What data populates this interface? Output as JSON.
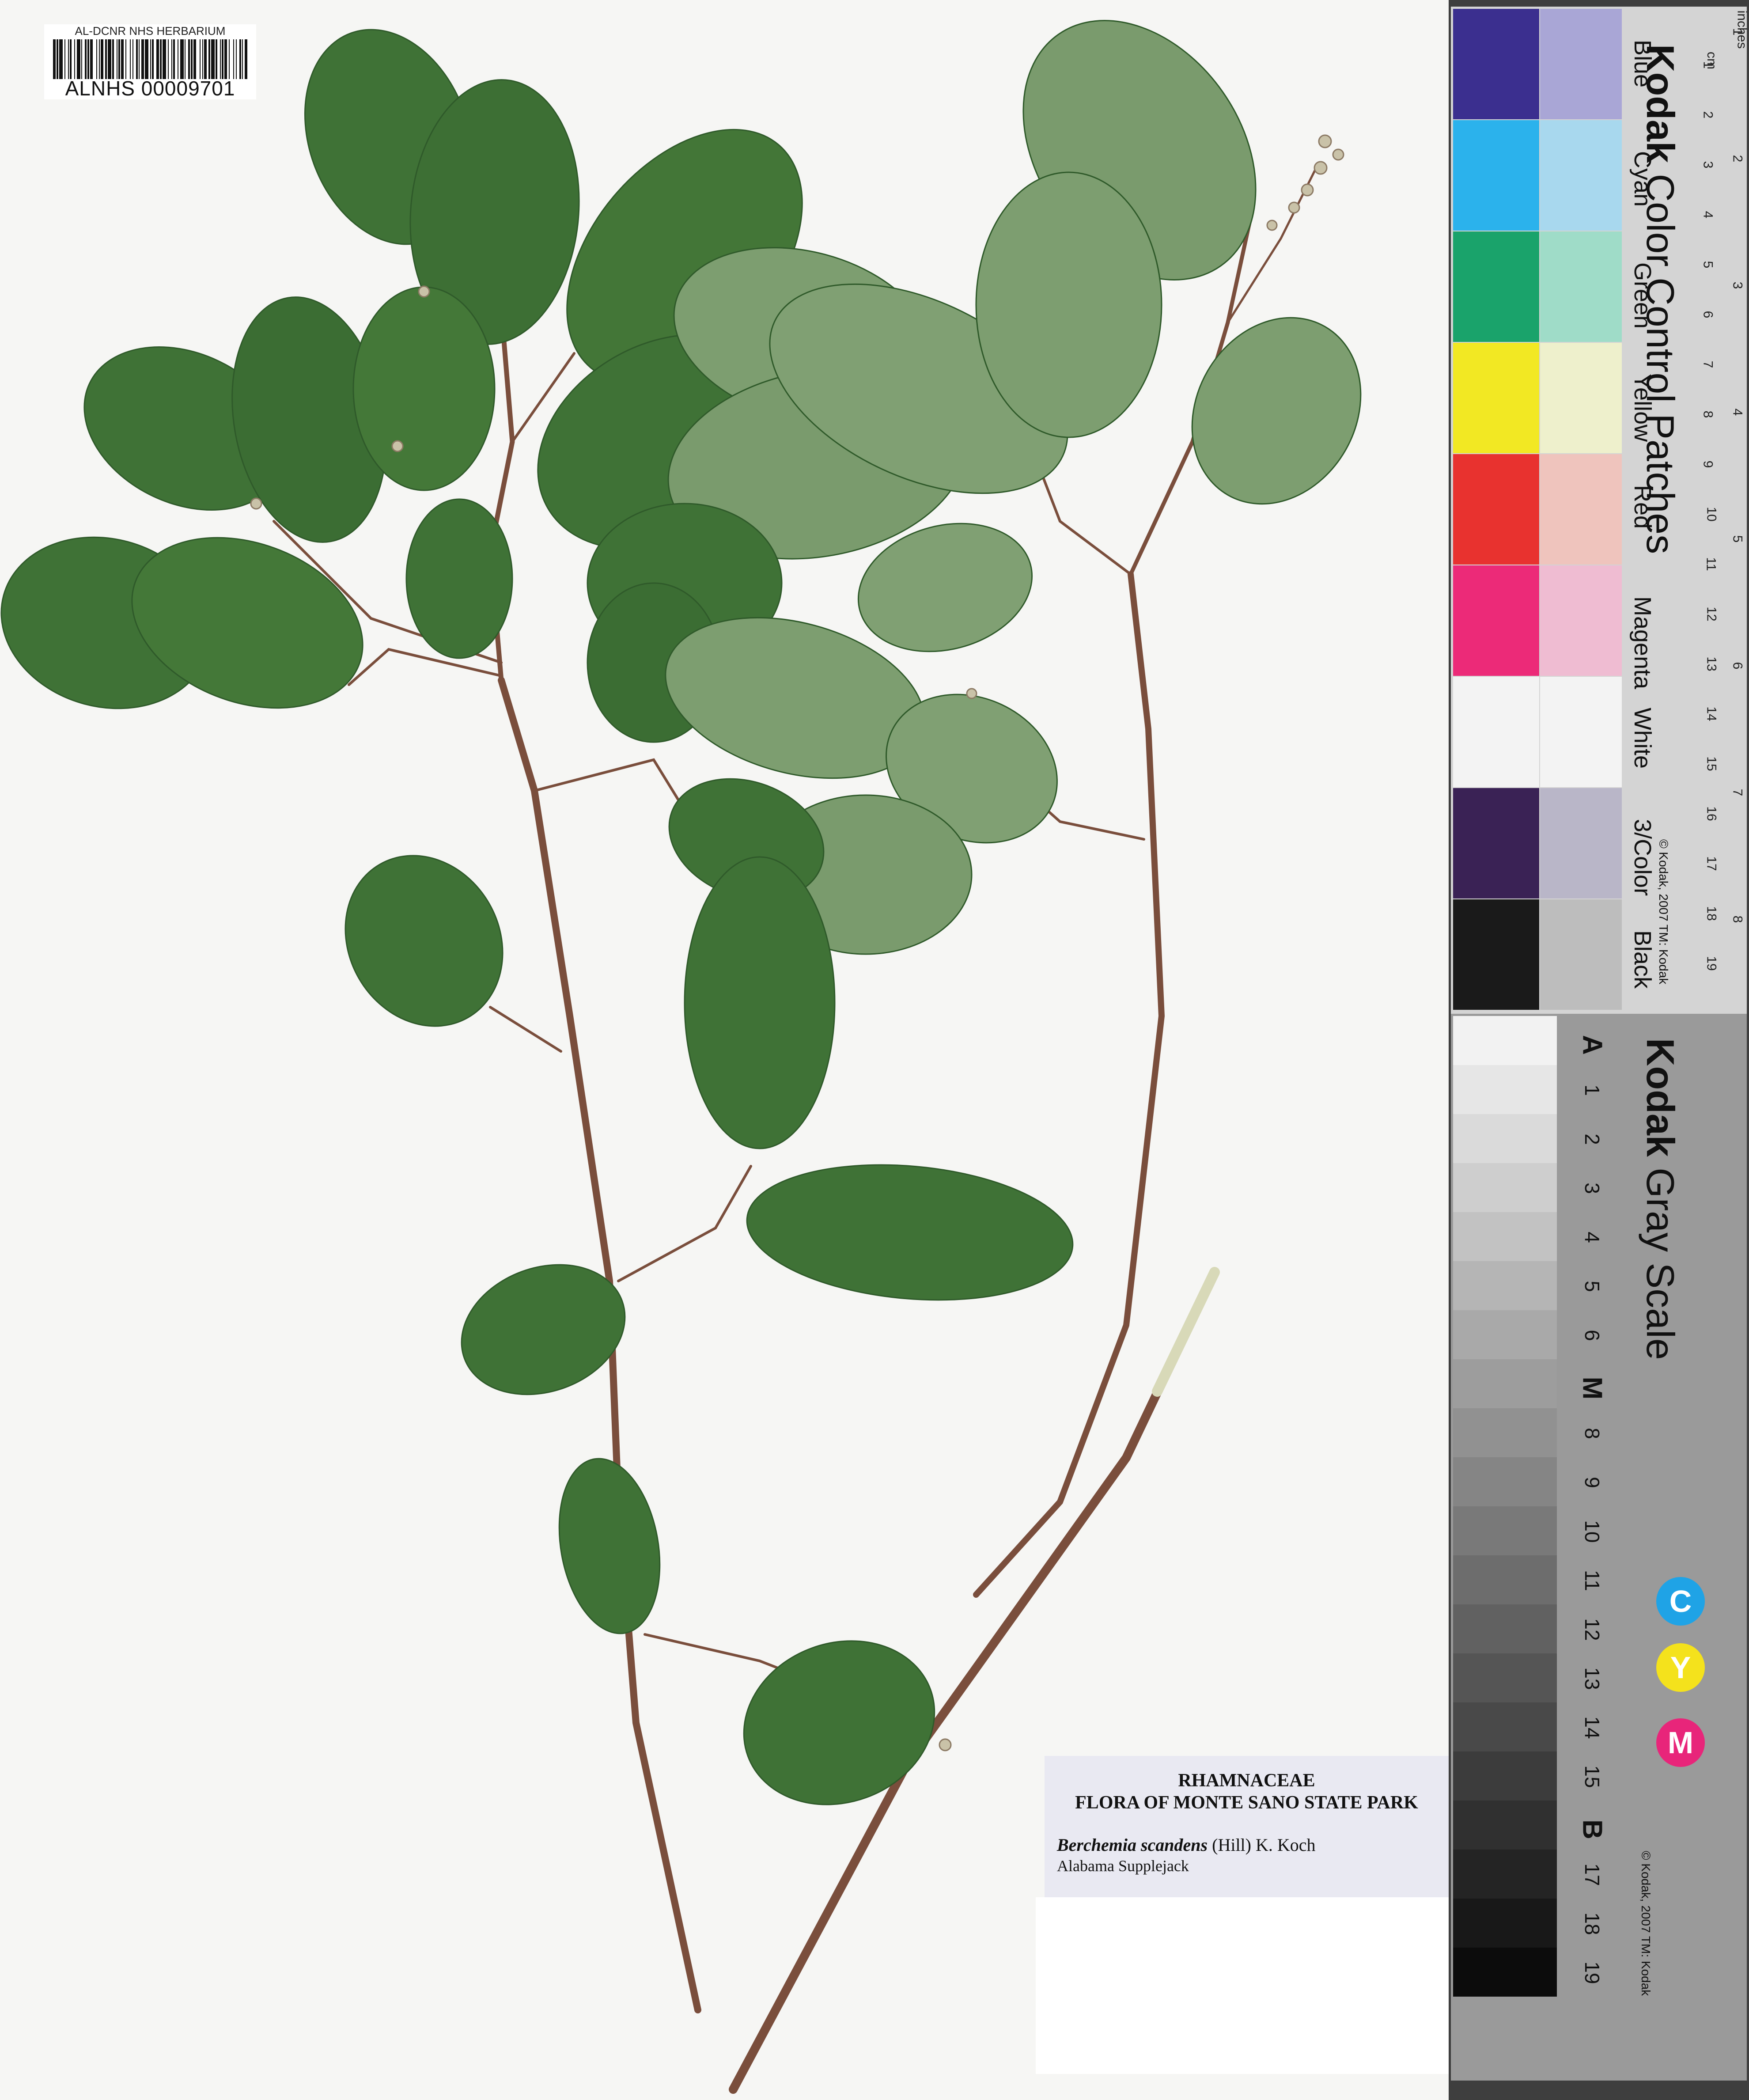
{
  "barcode": {
    "header": "AL-DCNR NHS HERBARIUM",
    "number": "ALNHS 00009701"
  },
  "label": {
    "family": "RHAMNACEAE",
    "flora": "FLORA OF MONTE SANO STATE PARK",
    "scientific_name": "Berchemia scandens",
    "author": "(Hill) K. Koch",
    "common_name": "Alabama Supplejack"
  },
  "color_card": {
    "brand": "Kodak",
    "title": "Color Control Patches",
    "patches": [
      {
        "name": "Blue",
        "dark": "#3b2f8f",
        "light": "#a9a6d6"
      },
      {
        "name": "Cyan",
        "dark": "#2bb2ec",
        "light": "#a8d8ee"
      },
      {
        "name": "Green",
        "dark": "#1aa36b",
        "light": "#9fdcc8"
      },
      {
        "name": "Yellow",
        "dark": "#f2e823",
        "light": "#eef0cc"
      },
      {
        "name": "Red",
        "dark": "#e8322f",
        "light": "#efc4bd"
      },
      {
        "name": "Magenta",
        "dark": "#ec2a78",
        "light": "#efbcd2"
      },
      {
        "name": "White",
        "dark": "#f3f3f3",
        "light": "#f3f3f3"
      },
      {
        "name": "3/Color",
        "dark": "#3a2255",
        "light": "#b9b6c8"
      },
      {
        "name": "Black",
        "dark": "#1a1a1a",
        "light": "#bdbdbd"
      }
    ],
    "copyright": "© Kodak, 2007 TM: Kodak",
    "ruler_label_cm": "cm",
    "ruler_label_inches": "inches",
    "ruler_cm": [
      "1",
      "2",
      "3",
      "4",
      "5",
      "6",
      "7",
      "8",
      "9",
      "10",
      "11",
      "12",
      "13",
      "14",
      "15",
      "16",
      "17",
      "18",
      "19"
    ],
    "ruler_in": [
      "1",
      "2",
      "3",
      "4",
      "5",
      "6",
      "7",
      "8"
    ]
  },
  "gray_card": {
    "brand": "Kodak",
    "title": "Gray Scale",
    "steps": [
      "A",
      "1",
      "2",
      "3",
      "4",
      "5",
      "6",
      "M",
      "8",
      "9",
      "10",
      "11",
      "12",
      "13",
      "14",
      "15",
      "B",
      "17",
      "18",
      "19"
    ],
    "cym": [
      "C",
      "Y",
      "M"
    ],
    "cym_colors": [
      "#1fa3e6",
      "#f4e21c",
      "#e8257a"
    ],
    "copyright": "© Kodak, 2007 TM: Kodak"
  },
  "colors": {
    "leaf_dark": "#3f7236",
    "leaf_light": "#7d9e70",
    "stem": "#7a4e3c",
    "sheet": "#f6f6f4"
  }
}
